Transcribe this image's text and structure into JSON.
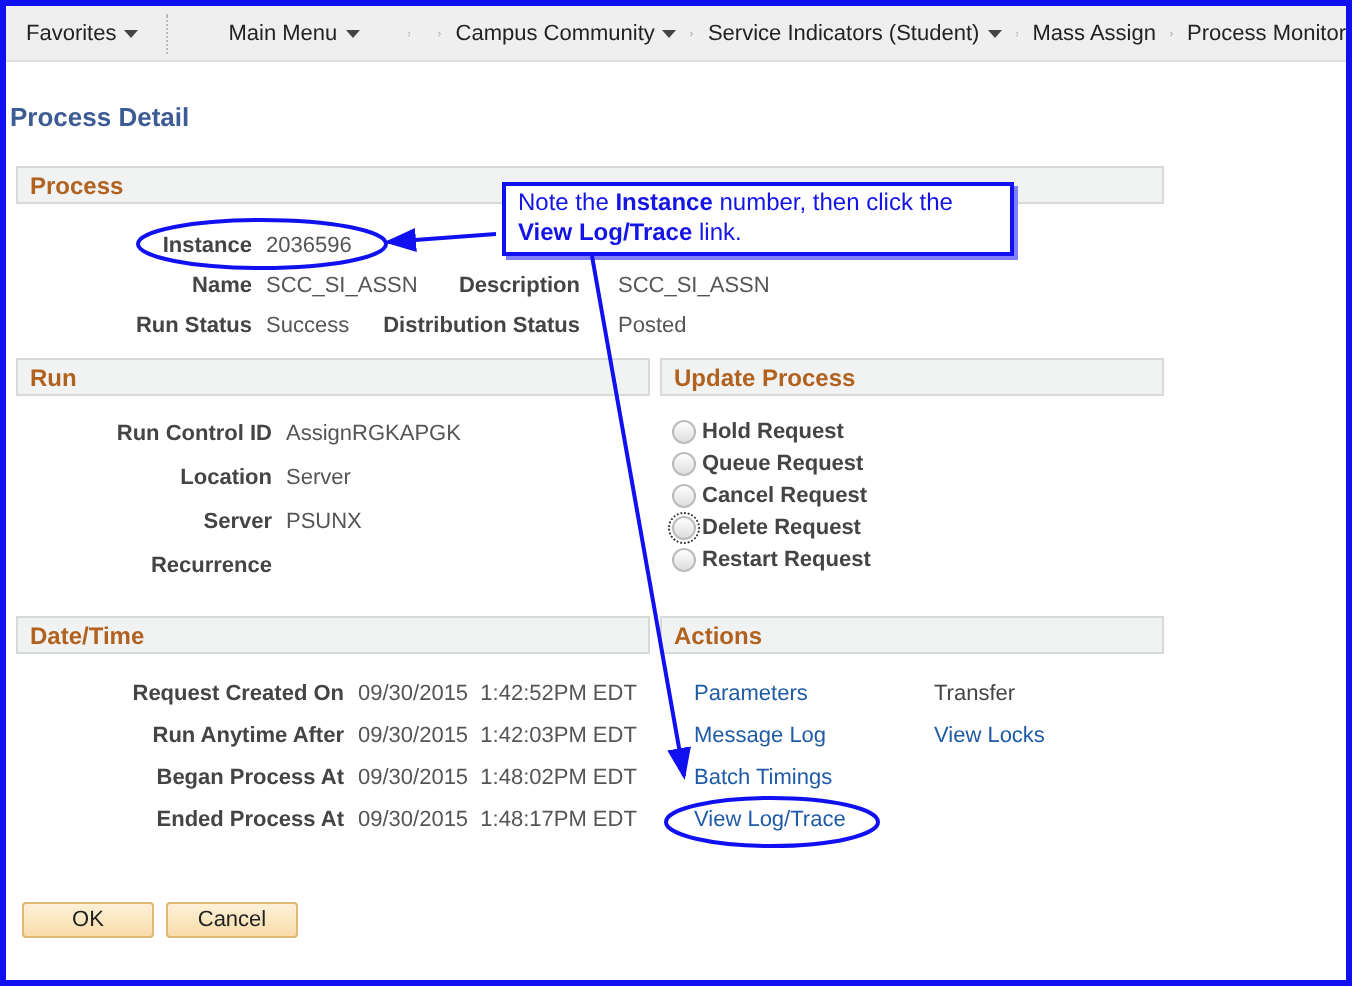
{
  "nav": {
    "items": [
      {
        "label": "Favorites",
        "dropdown": true
      },
      {
        "label": "Main Menu",
        "dropdown": true
      },
      {
        "label": "Campus Community",
        "dropdown": true
      },
      {
        "label": "Service Indicators (Student)",
        "dropdown": true
      },
      {
        "label": "Mass Assign",
        "dropdown": false
      },
      {
        "label": "Process Monitor",
        "dropdown": false
      }
    ]
  },
  "page_title": "Process Detail",
  "process": {
    "header": "Process",
    "rows": [
      {
        "label": "Instance",
        "value": "2036596"
      },
      {
        "label": "Name",
        "value": "SCC_SI_ASSN",
        "label_2": "Description",
        "value_2": "SCC_SI_ASSN"
      },
      {
        "label": "Run Status",
        "value": "Success",
        "label_2": "Distribution Status",
        "value_2": "Posted"
      }
    ]
  },
  "run": {
    "header": "Run",
    "rows": [
      {
        "label": "Run Control ID",
        "value": "AssignRGKAPGK"
      },
      {
        "label": "Location",
        "value": "Server"
      },
      {
        "label": "Server",
        "value": "PSUNX"
      },
      {
        "label": "Recurrence"
      }
    ]
  },
  "update_process": {
    "header": "Update Process",
    "options": [
      {
        "label": "Hold Request",
        "selected": false,
        "focused": false
      },
      {
        "label": "Queue Request",
        "selected": false,
        "focused": false
      },
      {
        "label": "Cancel Request",
        "selected": false,
        "focused": false
      },
      {
        "label": "Delete Request",
        "selected": false,
        "focused": true
      },
      {
        "label": "Restart Request",
        "selected": false,
        "focused": false
      }
    ]
  },
  "date_time": {
    "header": "Date/Time",
    "rows": [
      {
        "label": "Request Created On",
        "value": "09/30/2015  1:42:52PM EDT"
      },
      {
        "label": "Run Anytime After",
        "value": "09/30/2015  1:42:03PM EDT"
      },
      {
        "label": "Began Process At",
        "value": "09/30/2015  1:48:02PM EDT"
      },
      {
        "label": "Ended Process At",
        "value": "09/30/2015  1:48:17PM EDT"
      }
    ]
  },
  "actions": {
    "header": "Actions",
    "column_1": [
      {
        "label": "Parameters",
        "disabled": false
      },
      {
        "label": "Message Log",
        "disabled": false
      },
      {
        "label": "Batch Timings",
        "disabled": false
      },
      {
        "label": "View Log/Trace",
        "disabled": false
      }
    ],
    "column_2": [
      {
        "label": "Transfer",
        "disabled": true
      },
      {
        "label": "View Locks",
        "disabled": false
      }
    ]
  },
  "buttons": [
    "OK",
    "Cancel"
  ],
  "callout": {
    "text": "Note the **Instance** number, then click the **View Log/Trace** link."
  }
}
